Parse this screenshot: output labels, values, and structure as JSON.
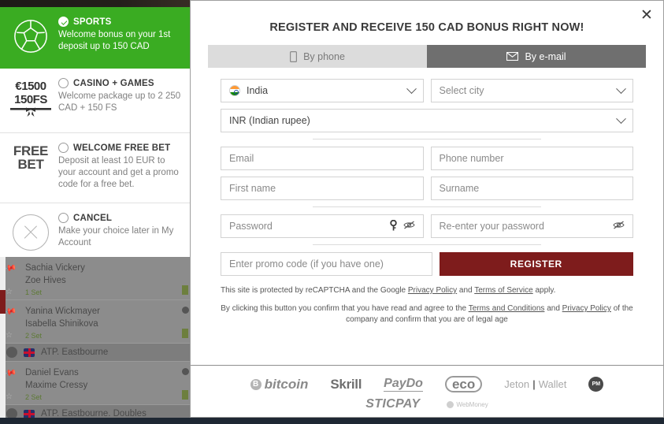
{
  "bonus_panel": {
    "options": [
      {
        "id": "sports",
        "title": "SPORTS",
        "desc": "Welcome bonus on your 1st deposit up to 150 CAD",
        "selected": true,
        "icon": "football-icon"
      },
      {
        "id": "casino",
        "title": "CASINO + GAMES",
        "desc": "Welcome package up to 2 250 CAD + 150 FS",
        "selected": false,
        "icon": "gift-1500-150fs-icon",
        "icon_line1": "€1500",
        "icon_line2": "150FS"
      },
      {
        "id": "freebet",
        "title": "WELCOME FREE BET",
        "desc": "Deposit at least 10 EUR to your account and get a promo code for a free bet.",
        "selected": false,
        "icon": "free-bet-icon",
        "icon_line1": "FREE",
        "icon_line2": "BET"
      },
      {
        "id": "cancel",
        "title": "CANCEL",
        "desc": "Make your choice later in My Account",
        "selected": false,
        "icon": "cancel-circle-icon"
      }
    ]
  },
  "event_list": {
    "entries": [
      {
        "type": "match",
        "player1": "Sachia Vickery",
        "player2": "Zoe Hives",
        "meta": "1 Set"
      },
      {
        "type": "match",
        "player1": "Yanina Wickmayer",
        "player2": "Isabella Shinikova",
        "meta": "2 Set"
      },
      {
        "type": "league",
        "name": "ATP. Eastbourne"
      },
      {
        "type": "match",
        "player1": "Daniel Evans",
        "player2": "Maxime Cressy",
        "meta": "2 Set"
      },
      {
        "type": "league",
        "name": "ATP. Eastbourne. Doubles"
      }
    ]
  },
  "modal": {
    "close_label": "✕",
    "title": "REGISTER AND RECEIVE 150 CAD BONUS RIGHT NOW!",
    "tabs": [
      {
        "id": "by-phone",
        "label": "By phone",
        "icon": "phone-icon",
        "active": false
      },
      {
        "id": "by-email",
        "label": "By e-mail",
        "icon": "envelope-icon",
        "active": true
      }
    ],
    "form": {
      "country": {
        "value": "India",
        "flag": "india-flag-icon"
      },
      "city": {
        "placeholder": "Select city"
      },
      "currency": {
        "value": "INR (Indian rupee)"
      },
      "email": {
        "placeholder": "Email"
      },
      "phone": {
        "placeholder": "Phone number"
      },
      "first_name": {
        "placeholder": "First name"
      },
      "surname": {
        "placeholder": "Surname"
      },
      "password": {
        "placeholder": "Password"
      },
      "password_confirm": {
        "placeholder": "Re-enter your password"
      },
      "promo": {
        "placeholder": "Enter promo code (if you have one)"
      },
      "register_button": "REGISTER"
    },
    "legal": {
      "recaptcha_prefix": "This site is protected by reCAPTCHA and the Google ",
      "recaptcha_link1": "Privacy Policy",
      "recaptcha_mid": " and ",
      "recaptcha_link2": "Terms of Service",
      "recaptcha_suffix": " apply.",
      "terms_prefix": "By clicking this button you confirm that you have read and agree to the ",
      "terms_link1": "Terms and Conditions",
      "terms_mid": " and ",
      "terms_link2": "Privacy Policy",
      "terms_suffix": " of the company and confirm that you are of legal age"
    },
    "payments": {
      "row1": [
        {
          "id": "bitcoin",
          "label": "bitcoin",
          "badge": "B"
        },
        {
          "id": "skrill",
          "label": "Skrill"
        },
        {
          "id": "paydo",
          "label": "PayDo"
        },
        {
          "id": "eco",
          "label": "eco"
        },
        {
          "id": "jeton",
          "label": "Jeton",
          "label2": "Wallet"
        },
        {
          "id": "pm",
          "label": "PM"
        }
      ],
      "row2": [
        {
          "id": "sticpay",
          "label": "STICPAY"
        },
        {
          "id": "webmoney",
          "label": "WebMoney"
        }
      ]
    }
  },
  "colors": {
    "accent_green": "#3aac22",
    "register_red": "#7e1c1c",
    "tab_active": "#6f6f6f",
    "tab_inactive": "#dcdcdc"
  }
}
